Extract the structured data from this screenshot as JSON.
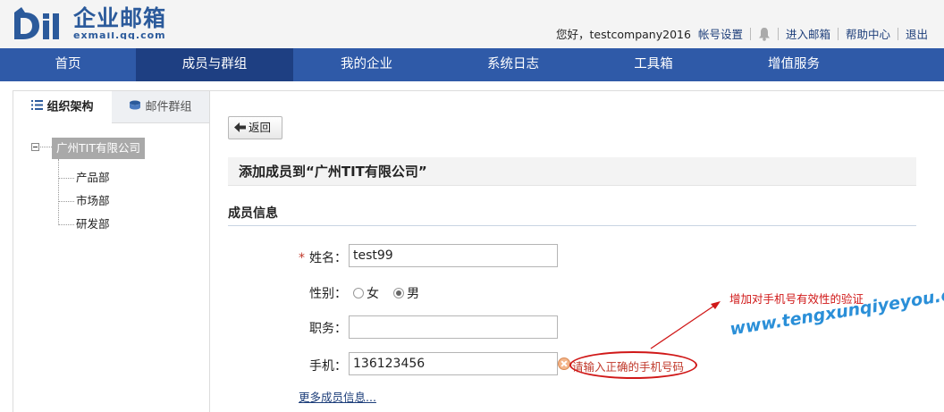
{
  "header": {
    "logo_title": "企业邮箱",
    "logo_sub": "exmail.qq.com",
    "greeting": "您好，testcompany2016",
    "links": {
      "account_settings": "帐号设置",
      "enter_mailbox": "进入邮箱",
      "help_center": "帮助中心",
      "logout": "退出"
    }
  },
  "nav": {
    "items": [
      {
        "label": "首页"
      },
      {
        "label": "成员与群组",
        "active": true
      },
      {
        "label": "我的企业"
      },
      {
        "label": "系统日志"
      },
      {
        "label": "工具箱"
      },
      {
        "label": "增值服务"
      }
    ]
  },
  "sidebar": {
    "tabs": [
      {
        "label": "组织架构",
        "icon": "list-icon",
        "active": true
      },
      {
        "label": "邮件群组",
        "icon": "group-icon"
      }
    ],
    "tree": {
      "root": "广州TIT有限公司",
      "children": [
        "产品部",
        "市场部",
        "研发部"
      ]
    }
  },
  "main": {
    "back_label": "返回",
    "title": "添加成员到“广州TIT有限公司”",
    "section_title": "成员信息",
    "form": {
      "name_label": "姓名：",
      "name_value": "test99",
      "gender_label": "性别：",
      "gender_options": [
        "女",
        "男"
      ],
      "gender_selected": "男",
      "position_label": "职务：",
      "position_value": "",
      "phone_label": "手机：",
      "phone_value": "136123456",
      "phone_error": "请输入正确的手机号码",
      "more_link": "更多成员信息..."
    }
  },
  "annotation": {
    "note": "增加对手机号有效性的验证",
    "watermark": "www.tengxunqiyeyou.com"
  },
  "colors": {
    "nav_bg": "#2f5aa8",
    "nav_active": "#1e3f82",
    "annotation_red": "#d01818",
    "watermark_blue": "#2a8fd8"
  }
}
